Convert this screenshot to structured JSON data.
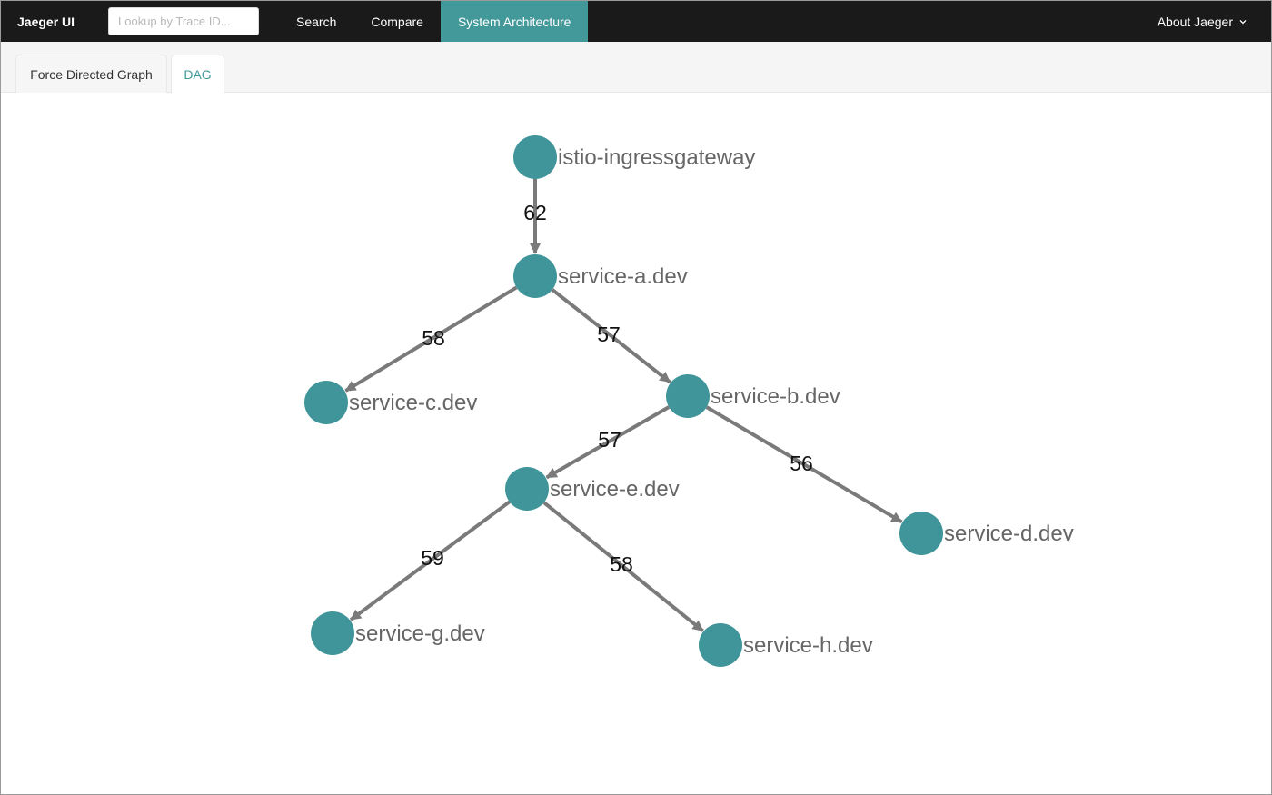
{
  "app": {
    "brand": "Jaeger UI"
  },
  "search": {
    "placeholder": "Lookup by Trace ID..."
  },
  "nav": {
    "search": "Search",
    "compare": "Compare",
    "system_architecture": "System Architecture",
    "about": "About Jaeger"
  },
  "tabs": {
    "force_directed": "Force Directed Graph",
    "dag": "DAG"
  },
  "colors": {
    "accent": "#43989a",
    "node": "#3f9599",
    "edge": "#7a7a7a",
    "topbar": "#1a1a1a"
  },
  "graph": {
    "nodes": [
      {
        "id": "istio-ingressgateway",
        "label": "istio-ingressgateway"
      },
      {
        "id": "service-a",
        "label": "service-a.dev"
      },
      {
        "id": "service-c",
        "label": "service-c.dev"
      },
      {
        "id": "service-b",
        "label": "service-b.dev"
      },
      {
        "id": "service-e",
        "label": "service-e.dev"
      },
      {
        "id": "service-d",
        "label": "service-d.dev"
      },
      {
        "id": "service-g",
        "label": "service-g.dev"
      },
      {
        "id": "service-h",
        "label": "service-h.dev"
      }
    ],
    "edges": [
      {
        "from": "istio-ingressgateway",
        "to": "service-a",
        "label": "62"
      },
      {
        "from": "service-a",
        "to": "service-c",
        "label": "58"
      },
      {
        "from": "service-a",
        "to": "service-b",
        "label": "57"
      },
      {
        "from": "service-b",
        "to": "service-e",
        "label": "57"
      },
      {
        "from": "service-b",
        "to": "service-d",
        "label": "56"
      },
      {
        "from": "service-e",
        "to": "service-g",
        "label": "59"
      },
      {
        "from": "service-e",
        "to": "service-h",
        "label": "58"
      }
    ]
  }
}
